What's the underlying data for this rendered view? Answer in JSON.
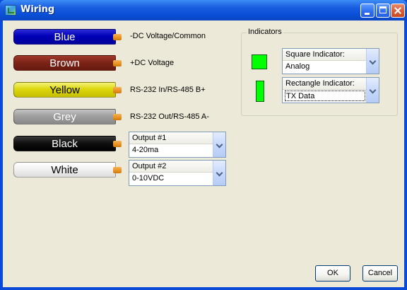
{
  "window": {
    "title": "Wiring"
  },
  "wires": [
    {
      "label": "Blue",
      "description": "-DC Voltage/Common"
    },
    {
      "label": "Brown",
      "description": "+DC Voltage"
    },
    {
      "label": "Yellow",
      "description": "RS-232  In/RS-485 B+"
    },
    {
      "label": "Grey",
      "description": "RS-232 Out/RS-485 A-"
    },
    {
      "label": "Black",
      "description": ""
    },
    {
      "label": "White",
      "description": ""
    }
  ],
  "outputs": [
    {
      "header": "Output #1",
      "value": "4-20ma"
    },
    {
      "header": "Output #2",
      "value": "0-10VDC"
    }
  ],
  "indicators": {
    "title": "Indicators",
    "square": {
      "header": "Square Indicator:",
      "value": "Analog",
      "color": "#00ff00"
    },
    "rectangle": {
      "header": "Rectangle Indicator:",
      "value": "TX Data",
      "color": "#00ff00"
    }
  },
  "buttons": {
    "ok": "OK",
    "cancel": "Cancel"
  }
}
